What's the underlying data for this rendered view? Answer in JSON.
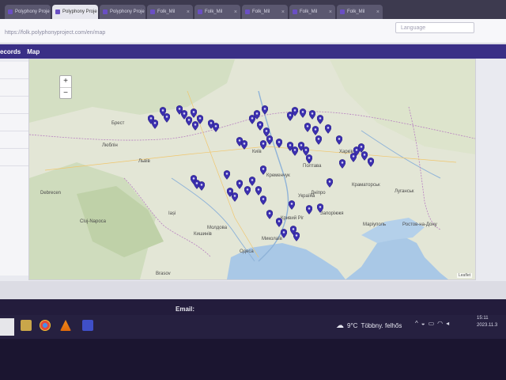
{
  "browser": {
    "tabs": [
      {
        "label": "Polyphony Proje"
      },
      {
        "label": "Polyphony Proje"
      },
      {
        "label": "Polyphony Proje"
      },
      {
        "label": "Folk_Mil"
      },
      {
        "label": "Folk_Mil"
      },
      {
        "label": "Folk_Mil"
      },
      {
        "label": "Folk_Mil"
      },
      {
        "label": "Folk_Mil"
      }
    ],
    "url": "https://folk.polyphonyproject.com/en/map"
  },
  "header": {
    "language_label": "Language"
  },
  "nav": {
    "records_label": "ecords",
    "map_label": "Map"
  },
  "map": {
    "zoom_in": "+",
    "zoom_out": "−",
    "attribution": "Leaflet",
    "marker_color": "#3b2fb0",
    "labels": {
      "ukraine": "Україна",
      "moldova": "Молдова",
      "mariupol": "Маріуполь",
      "rostov": "Ростов-на-Дону",
      "kyiv": "Київ",
      "lugansk": "Луганськ",
      "kryvyi_rih": "Кривий Ріг",
      "zaporizhzhia": "Запоріжжя",
      "dnipro": "Дніпро",
      "kharkiv": "Харків",
      "kramatorsk": "Краматорськ",
      "poltava": "Полтава",
      "brest": "Брест",
      "lublin": "Люблін",
      "lviv": "Львів",
      "kremenchuk": "Кременчук",
      "cluj": "Cluj-Napoca",
      "iasi": "Iași",
      "chisinau": "Кишинів",
      "mykolaiv": "Миколаїв",
      "odesa": "Одеса",
      "brasov": "Brasov",
      "debrecen": "Debrecen"
    }
  },
  "footer": {
    "email_label": "Email:"
  },
  "taskbar": {
    "weather_temp": "9°C",
    "weather_desc": "Többny. felhős",
    "clock_time": "15:11",
    "clock_date": "2023.11.3"
  }
}
